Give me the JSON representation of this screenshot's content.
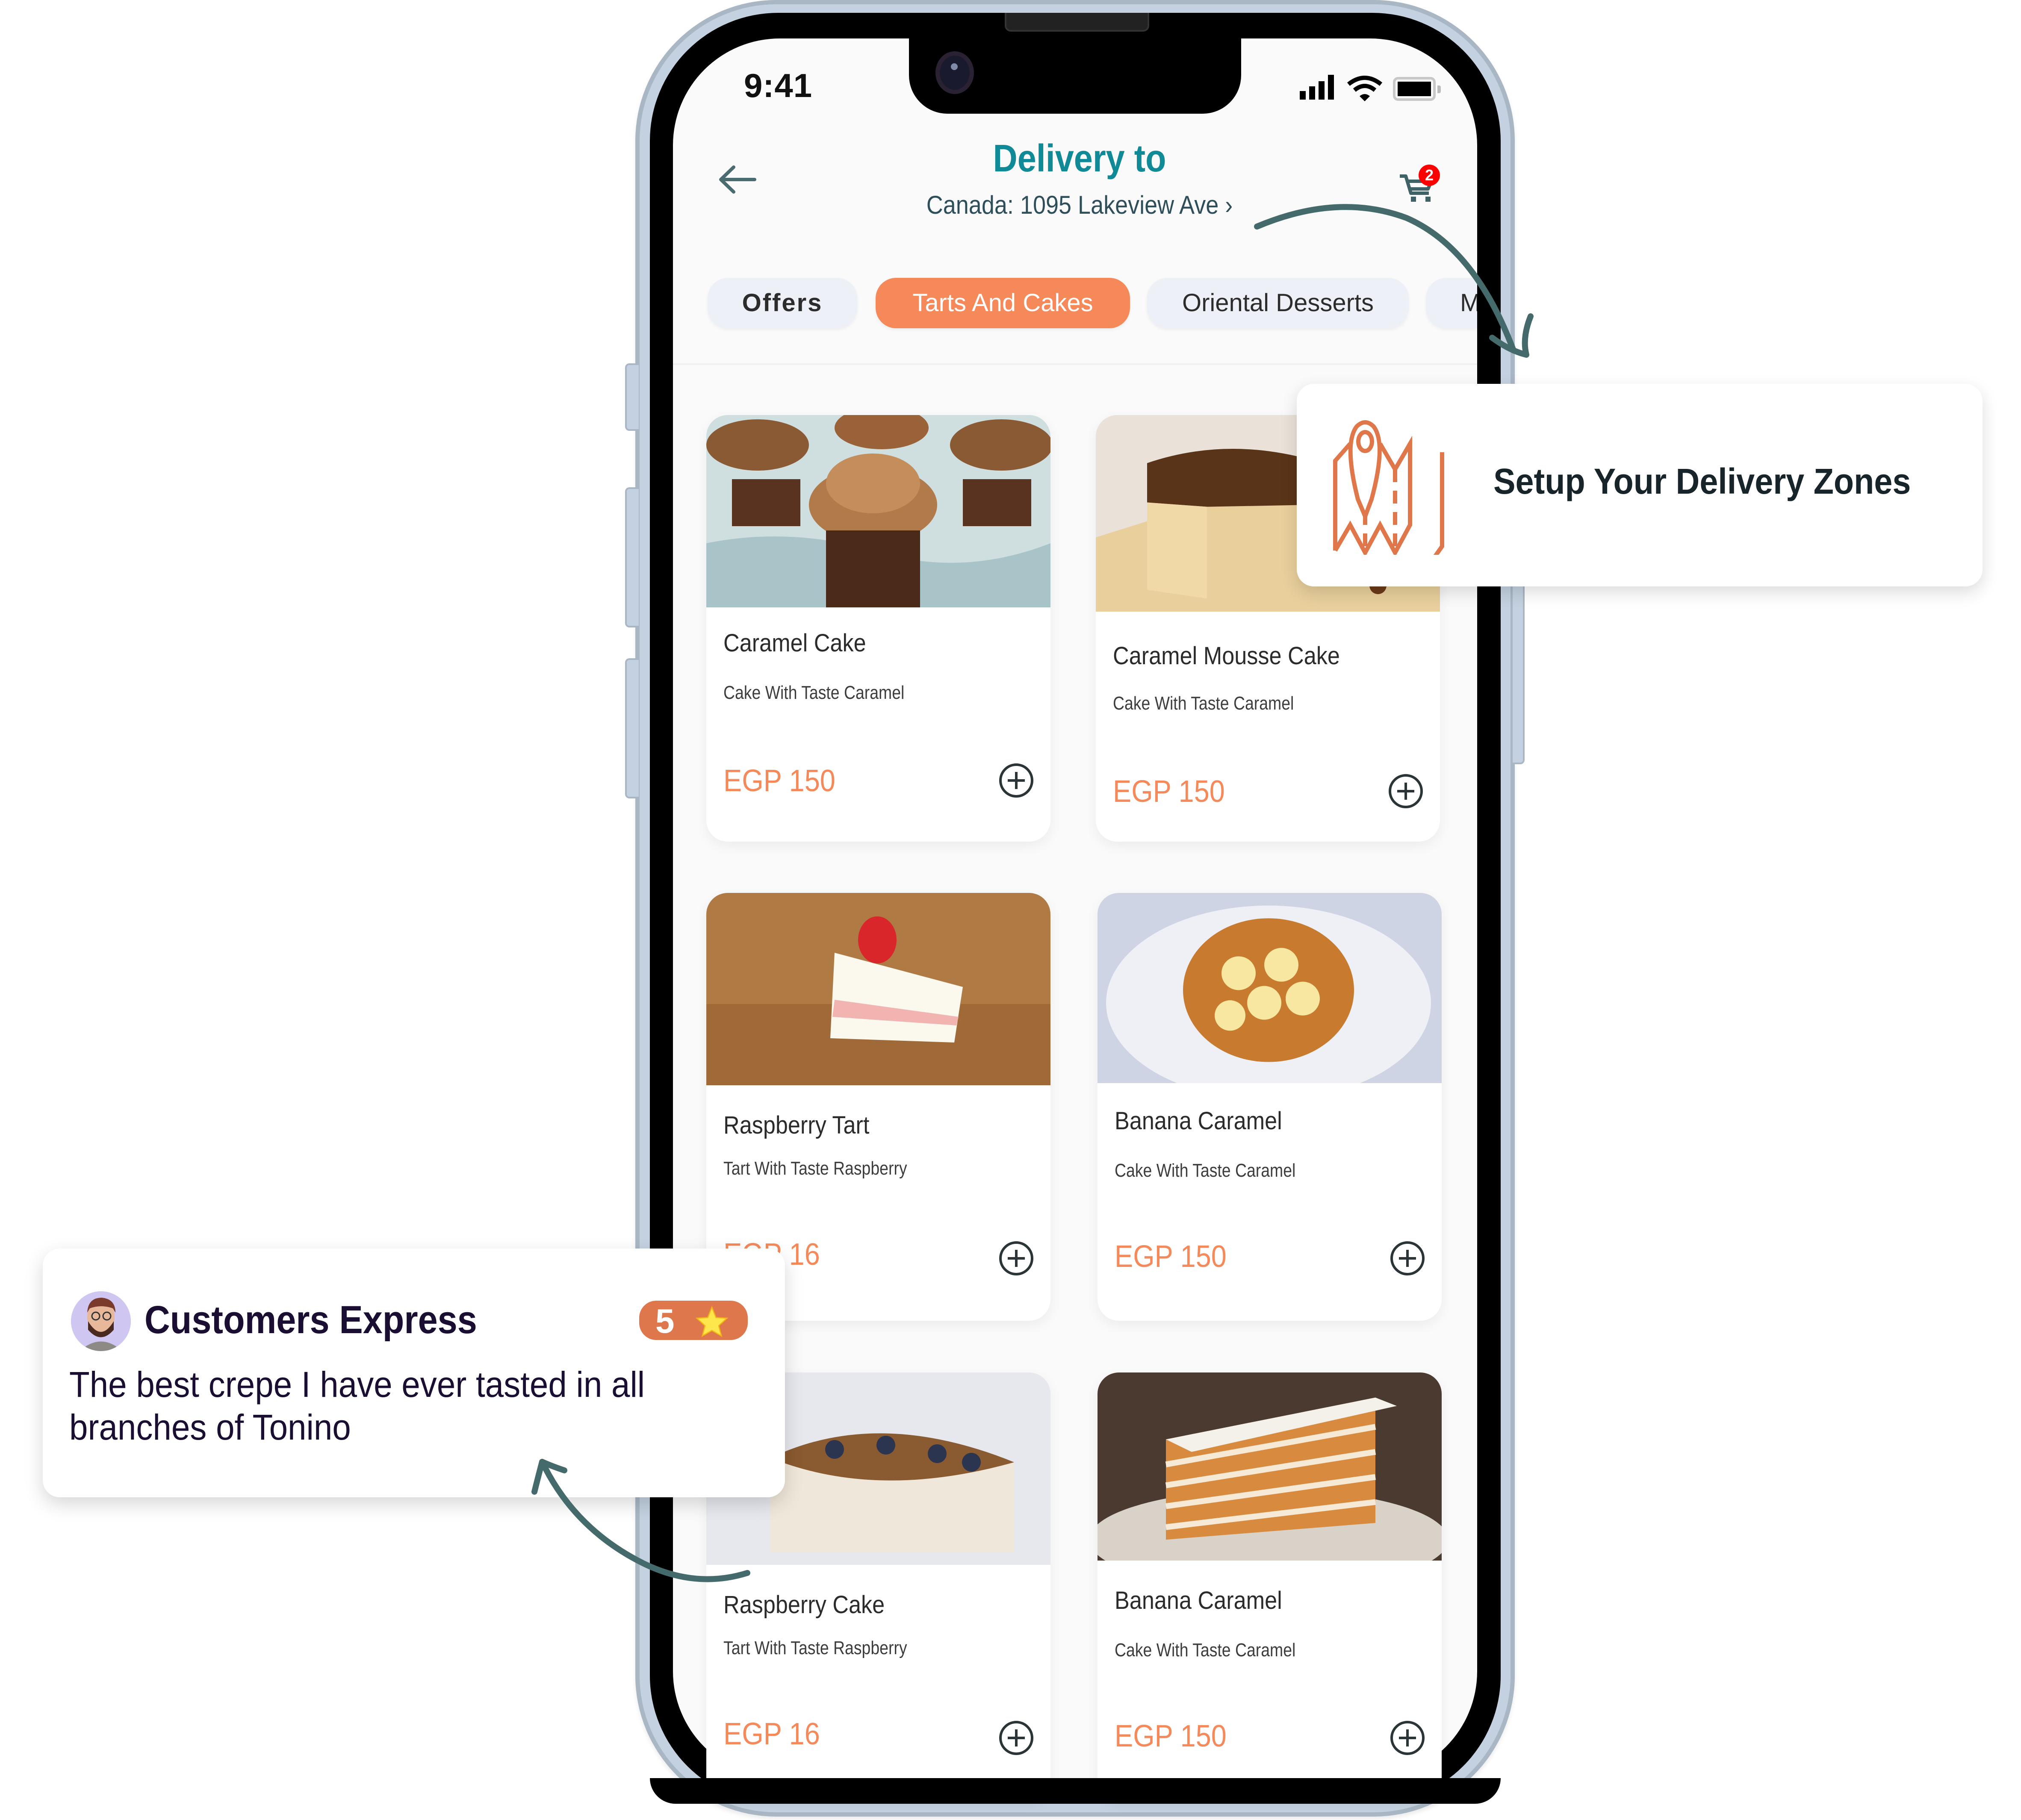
{
  "status_bar": {
    "time": "9:41",
    "icons": [
      "signal-icon",
      "wifi-icon",
      "battery-icon"
    ]
  },
  "header": {
    "back_icon": "arrow-left-icon",
    "title": "Delivery to",
    "address": "Canada: 1095 Lakeview Ave ›",
    "cart_icon": "cart-icon",
    "cart_count": "2"
  },
  "tabs": [
    {
      "label": "Offers",
      "active": false
    },
    {
      "label": "Tarts And Cakes",
      "active": true
    },
    {
      "label": "Oriental Desserts",
      "active": false
    },
    {
      "label": "M",
      "active": false
    }
  ],
  "products": [
    {
      "name": "Caramel Cake",
      "description": "Cake With Taste Caramel",
      "price": "EGP 150",
      "image": "cupcakes-photo"
    },
    {
      "name": "Caramel Mousse Cake",
      "description": "Cake With Taste Caramel",
      "price": "EGP 150",
      "image": "cheesecake-photo"
    },
    {
      "name": "Raspberry Tart",
      "description": "Tart With Taste Raspberry",
      "price": "EGP 16",
      "image": "strawberry-cake-slice-photo"
    },
    {
      "name": "Banana Caramel",
      "description": "Cake With Taste Caramel",
      "price": "EGP 150",
      "image": "banana-pancakes-photo"
    },
    {
      "name": "Raspberry Cake",
      "description": "Tart With Taste Raspberry",
      "price": "EGP 16",
      "image": "blueberry-cake-photo"
    },
    {
      "name": "Banana Caramel",
      "description": "Cake With Taste Caramel",
      "price": "EGP 150",
      "image": "layer-cake-photo"
    }
  ],
  "delivery_callout": {
    "icon": "map-pin-icon",
    "text": "Setup Your Delivery Zones"
  },
  "review_callout": {
    "reviewer": "Customers Express",
    "rating": "5",
    "rating_icon": "star-icon",
    "text": "The best crepe I have ever tasted in all branches of Tonino"
  },
  "colors": {
    "accent_orange": "#f5895a",
    "title_teal": "#108a97",
    "arrow_teal": "#446a6b",
    "badge_red": "#ff0000",
    "rating_badge": "#de774b",
    "map_icon": "#df774a"
  }
}
